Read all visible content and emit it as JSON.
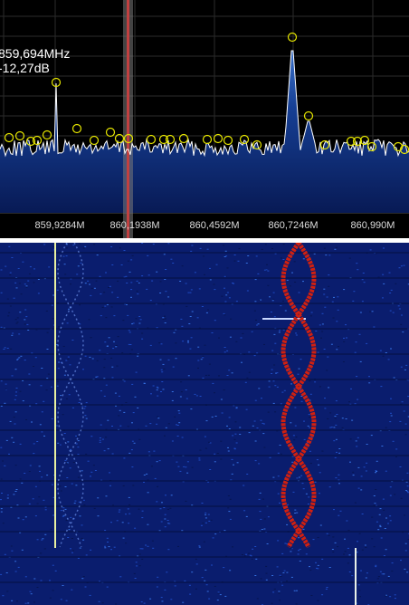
{
  "readout": {
    "frequency": "859,694MHz",
    "level": "-12,27dB"
  },
  "axis": {
    "tick_labels": [
      "859,9284M",
      "860,1938M",
      "860,4592M",
      "860,7246M",
      "860,990M"
    ]
  },
  "colors": {
    "spectrum_bg": "#000000",
    "spectrum_fill": "#0d2f7a",
    "trace": "#ffffff",
    "peak_marker": "#e6e600",
    "tuning_marker": "#c04040",
    "waterfall_bg": "#0a1d6e",
    "waterfall_signal": "#d02010"
  }
}
